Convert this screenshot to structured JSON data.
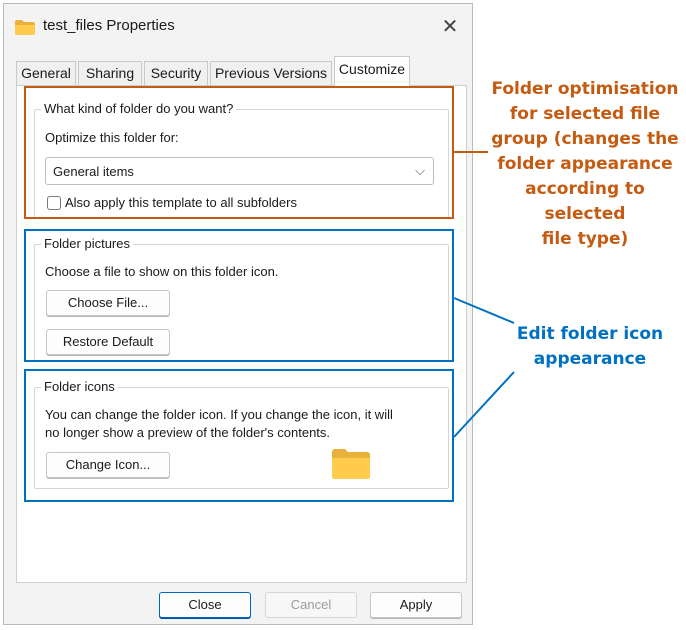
{
  "window": {
    "title": "test_files Properties",
    "close_glyph": "✕"
  },
  "tabs": [
    {
      "label": "General"
    },
    {
      "label": "Sharing"
    },
    {
      "label": "Security"
    },
    {
      "label": "Previous Versions"
    },
    {
      "label": "Customize",
      "active": true
    }
  ],
  "folder_type": {
    "group_title": "What kind of folder do you want?",
    "optimize_label": "Optimize this folder for:",
    "selected": "General items",
    "chevron": "⌵",
    "checkbox_label": "Also apply this template to all subfolders",
    "checkbox_checked": false
  },
  "folder_pictures": {
    "group_title": "Folder pictures",
    "description": "Choose a file to show on this folder icon.",
    "choose_button": "Choose File...",
    "restore_button": "Restore Default"
  },
  "folder_icons": {
    "group_title": "Folder icons",
    "description_line1": "You can change the folder icon. If you change the icon, it will",
    "description_line2": "no longer show a preview of the folder's contents.",
    "change_button": "Change Icon...",
    "preview_icon": "folder-icon"
  },
  "footer": {
    "close": "Close",
    "cancel": "Cancel",
    "apply": "Apply"
  },
  "annotations": {
    "orange_lines": [
      "Folder optimisation",
      "for selected file",
      "group (changes the",
      "folder appearance",
      "according to selected",
      "file type)"
    ],
    "blue_lines": [
      "Edit folder icon",
      "appearance"
    ],
    "orange_color": "#c55a11",
    "blue_color": "#0070c0"
  }
}
